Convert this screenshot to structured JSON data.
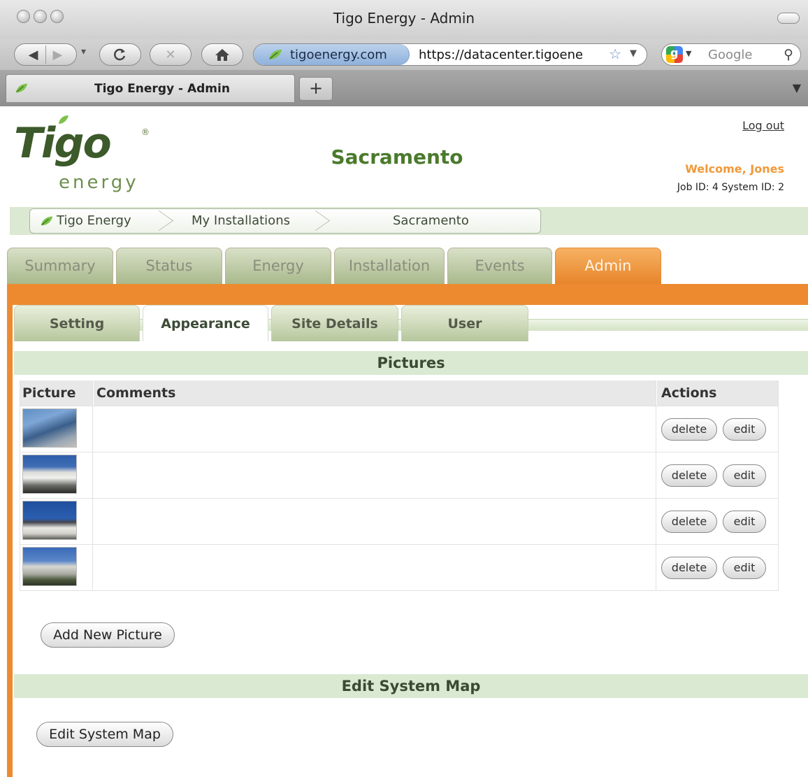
{
  "browser": {
    "window_title": "Tigo Energy - Admin",
    "url_site": "tigoenergy.com",
    "url": "https://datacenter.tigoene",
    "search_placeholder": "Google",
    "tab_title": "Tigo Energy - Admin",
    "new_tab_label": "+"
  },
  "header": {
    "logo_word": "Tigo",
    "logo_sub": "energy",
    "logo_reg": "®",
    "site_name": "Sacramento",
    "logout": "Log out",
    "welcome": "Welcome, Jones",
    "job_system": "Job ID: 4  System ID: 2"
  },
  "breadcrumb": [
    "Tigo Energy",
    "My Installations",
    "Sacramento"
  ],
  "main_tabs": [
    "Summary",
    "Status",
    "Energy",
    "Installation",
    "Events",
    "Admin"
  ],
  "active_main_tab": "Admin",
  "sub_tabs": [
    "Setting",
    "Appearance",
    "Site Details",
    "User"
  ],
  "active_sub_tab": "Appearance",
  "pictures": {
    "title": "Pictures",
    "headers": {
      "picture": "Picture",
      "comments": "Comments",
      "actions": "Actions"
    },
    "rows": [
      {
        "comment": "",
        "delete": "delete",
        "edit": "edit"
      },
      {
        "comment": "",
        "delete": "delete",
        "edit": "edit"
      },
      {
        "comment": "",
        "delete": "delete",
        "edit": "edit"
      },
      {
        "comment": "",
        "delete": "delete",
        "edit": "edit"
      }
    ],
    "add_button": "Add New Picture"
  },
  "system_map": {
    "title": "Edit System Map",
    "button": "Edit System Map"
  },
  "colors": {
    "accent_orange": "#ed8a2f",
    "brand_green": "#4a7a2c",
    "section_green": "#d9e9d2"
  }
}
